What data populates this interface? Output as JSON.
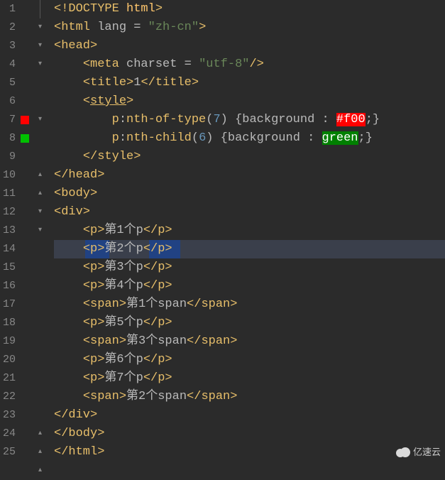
{
  "highlighted_line_index": 13,
  "watermark_text": "亿速云",
  "lines": [
    {
      "num": "1",
      "fold": "open",
      "tokens": [
        {
          "t": "<!DOCTYPE ",
          "c": "t-tag"
        },
        {
          "t": "html",
          "c": "c-yellow"
        },
        {
          "t": ">",
          "c": "t-tag"
        }
      ],
      "indent": 0
    },
    {
      "num": "2",
      "fold": "open",
      "tokens": [
        {
          "t": "<html ",
          "c": "t-tag"
        },
        {
          "t": "lang ",
          "c": "t-attr"
        },
        {
          "t": "= ",
          "c": "t-eq"
        },
        {
          "t": "\"zh-cn\"",
          "c": "t-str"
        },
        {
          "t": ">",
          "c": "t-tag"
        }
      ],
      "indent": 0
    },
    {
      "num": "3",
      "fold": "open",
      "tokens": [
        {
          "t": "<head>",
          "c": "t-tag"
        }
      ],
      "indent": 0
    },
    {
      "num": "4",
      "tokens": [
        {
          "t": "<meta ",
          "c": "t-tag"
        },
        {
          "t": "charset ",
          "c": "t-attr"
        },
        {
          "t": "= ",
          "c": "t-eq"
        },
        {
          "t": "\"utf-8\"",
          "c": "t-str"
        },
        {
          "t": "/>",
          "c": "t-tag"
        }
      ],
      "indent": 1
    },
    {
      "num": "5",
      "tokens": [
        {
          "t": "<title>",
          "c": "t-tag"
        },
        {
          "t": "1",
          "c": "t-text"
        },
        {
          "t": "</title>",
          "c": "t-tag"
        }
      ],
      "indent": 1
    },
    {
      "num": "6",
      "fold": "open",
      "tokens": [
        {
          "t": "<",
          "c": "t-tag"
        },
        {
          "t": "style",
          "c": "t-tag underline"
        },
        {
          "t": ">",
          "c": "t-tag"
        }
      ],
      "indent": 1
    },
    {
      "num": "7",
      "mark": "red",
      "tokens": [
        {
          "t": "p",
          "c": "t-ident"
        },
        {
          "t": ":",
          "c": "t-punc"
        },
        {
          "t": "nth-of-type",
          "c": "t-ident"
        },
        {
          "t": "(",
          "c": "t-punc"
        },
        {
          "t": "7",
          "c": "t-num"
        },
        {
          "t": ") ",
          "c": "t-punc"
        },
        {
          "t": "{",
          "c": "t-punc"
        },
        {
          "t": "background ",
          "c": "t-key"
        },
        {
          "t": ": ",
          "c": "t-punc"
        },
        {
          "t": "#f00",
          "c": "t-red"
        },
        {
          "t": ";",
          "c": "t-punc"
        },
        {
          "t": "}",
          "c": "t-punc"
        }
      ],
      "indent": 2
    },
    {
      "num": "8",
      "mark": "green",
      "tokens": [
        {
          "t": "p",
          "c": "t-ident"
        },
        {
          "t": ":",
          "c": "t-punc"
        },
        {
          "t": "nth-child",
          "c": "t-ident"
        },
        {
          "t": "(",
          "c": "t-punc"
        },
        {
          "t": "6",
          "c": "t-num"
        },
        {
          "t": ") ",
          "c": "t-punc"
        },
        {
          "t": "{",
          "c": "t-punc"
        },
        {
          "t": "background ",
          "c": "t-key"
        },
        {
          "t": ": ",
          "c": "t-punc"
        },
        {
          "t": "green",
          "c": "t-grn"
        },
        {
          "t": ";",
          "c": "t-punc"
        },
        {
          "t": "}",
          "c": "t-punc"
        }
      ],
      "indent": 2
    },
    {
      "num": "9",
      "fold": "close",
      "tokens": [
        {
          "t": "</style>",
          "c": "t-tag"
        }
      ],
      "indent": 1
    },
    {
      "num": "10",
      "fold": "close",
      "tokens": [
        {
          "t": "</head>",
          "c": "t-tag"
        }
      ],
      "indent": 0
    },
    {
      "num": "11",
      "fold": "open",
      "tokens": [
        {
          "t": "<body>",
          "c": "t-tag"
        }
      ],
      "indent": 0
    },
    {
      "num": "12",
      "fold": "open",
      "tokens": [
        {
          "t": "<div>",
          "c": "t-tag"
        }
      ],
      "indent": 0
    },
    {
      "num": "13",
      "tokens": [
        {
          "t": "<p>",
          "c": "t-tag"
        },
        {
          "t": "第1个p",
          "c": "t-text"
        },
        {
          "t": "</p>",
          "c": "t-tag"
        }
      ],
      "indent": 1
    },
    {
      "num": "14",
      "sel": true,
      "tokens": [
        {
          "t": "<p>",
          "c": "t-tag"
        },
        {
          "t": "第2个p",
          "c": "t-text"
        },
        {
          "t": "</p>",
          "c": "t-tag"
        }
      ],
      "indent": 1
    },
    {
      "num": "15",
      "tokens": [
        {
          "t": "<p>",
          "c": "t-tag"
        },
        {
          "t": "第3个p",
          "c": "t-text"
        },
        {
          "t": "</p>",
          "c": "t-tag"
        }
      ],
      "indent": 1
    },
    {
      "num": "16",
      "tokens": [
        {
          "t": "<p>",
          "c": "t-tag"
        },
        {
          "t": "第4个p",
          "c": "t-text"
        },
        {
          "t": "</p>",
          "c": "t-tag"
        }
      ],
      "indent": 1
    },
    {
      "num": "17",
      "tokens": [
        {
          "t": "<span>",
          "c": "t-tag"
        },
        {
          "t": "第1个span",
          "c": "t-text"
        },
        {
          "t": "</span>",
          "c": "t-tag"
        }
      ],
      "indent": 1
    },
    {
      "num": "18",
      "tokens": [
        {
          "t": "<p>",
          "c": "t-tag"
        },
        {
          "t": "第5个p",
          "c": "t-text"
        },
        {
          "t": "</p>",
          "c": "t-tag"
        }
      ],
      "indent": 1
    },
    {
      "num": "19",
      "tokens": [
        {
          "t": "<span>",
          "c": "t-tag"
        },
        {
          "t": "第3个span",
          "c": "t-text"
        },
        {
          "t": "</span>",
          "c": "t-tag"
        }
      ],
      "indent": 1
    },
    {
      "num": "20",
      "tokens": [
        {
          "t": "<p>",
          "c": "t-tag"
        },
        {
          "t": "第6个p",
          "c": "t-text"
        },
        {
          "t": "</p>",
          "c": "t-tag"
        }
      ],
      "indent": 1
    },
    {
      "num": "21",
      "tokens": [
        {
          "t": "<p>",
          "c": "t-tag"
        },
        {
          "t": "第7个p",
          "c": "t-text"
        },
        {
          "t": "</p>",
          "c": "t-tag"
        }
      ],
      "indent": 1
    },
    {
      "num": "22",
      "tokens": [
        {
          "t": "<span>",
          "c": "t-tag"
        },
        {
          "t": "第2个span",
          "c": "t-text"
        },
        {
          "t": "</span>",
          "c": "t-tag"
        }
      ],
      "indent": 1
    },
    {
      "num": "23",
      "fold": "close",
      "tokens": [
        {
          "t": "</div>",
          "c": "t-tag"
        }
      ],
      "indent": 0
    },
    {
      "num": "24",
      "fold": "close",
      "tokens": [
        {
          "t": "</body>",
          "c": "t-tag"
        }
      ],
      "indent": 0
    },
    {
      "num": "25",
      "fold": "close",
      "tokens": [
        {
          "t": "</html>",
          "c": "t-tag"
        }
      ],
      "indent": 0
    }
  ]
}
